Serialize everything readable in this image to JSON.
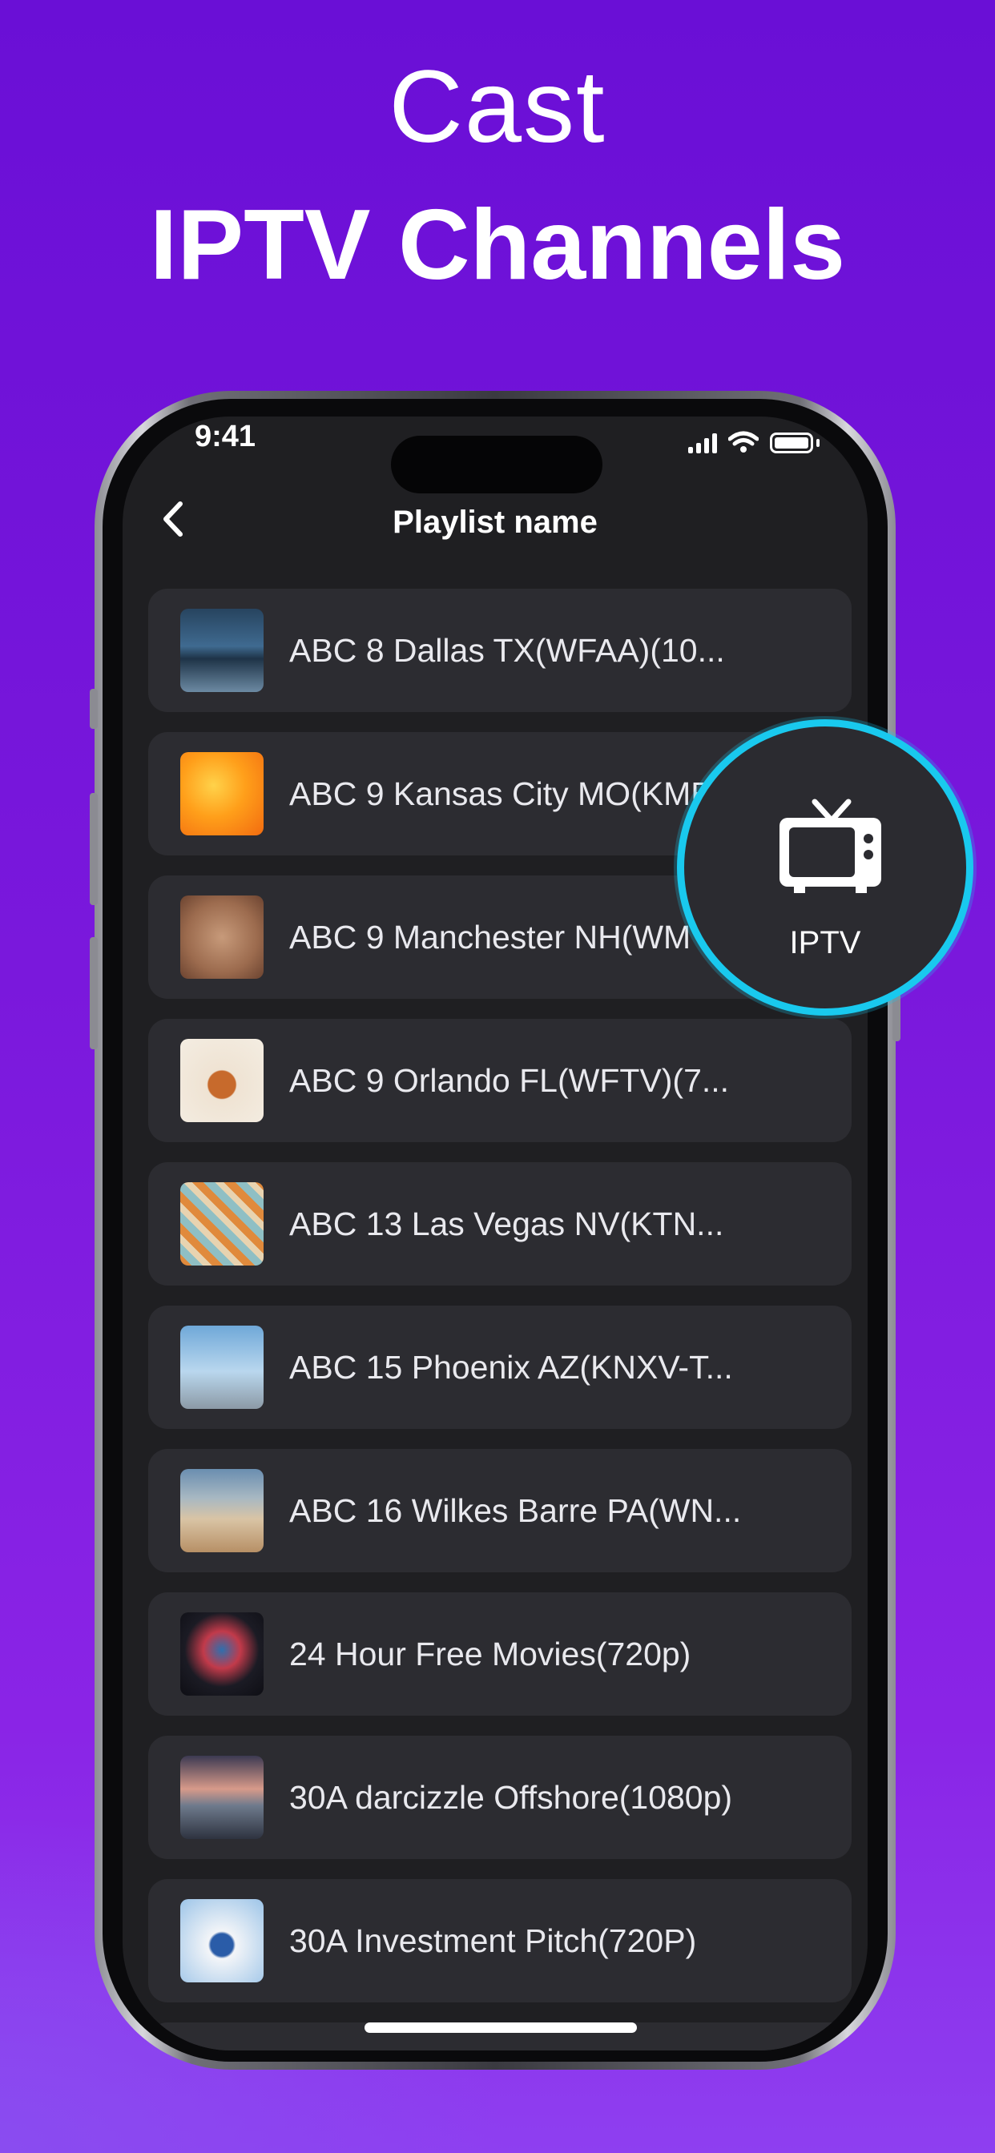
{
  "headline": {
    "line1": "Cast",
    "line2": "IPTV Channels"
  },
  "status_bar": {
    "time": "9:41"
  },
  "header": {
    "back_icon": "chevron-left-icon",
    "title": "Playlist name"
  },
  "channels": [
    {
      "name": "ABC 8 Dallas TX(WFAA)(10...",
      "thumb": "city-skyline-thumbnail"
    },
    {
      "name": "ABC 9 Kansas City MO(KMB",
      "thumb": "orange-abstract-thumbnail"
    },
    {
      "name": "ABC 9 Manchester NH(WM",
      "thumb": "brown-abstract-thumbnail"
    },
    {
      "name": "ABC 9 Orlando FL(WFTV)(7...",
      "thumb": "table-setting-thumbnail"
    },
    {
      "name": "ABC 13 Las Vegas NV(KTN...",
      "thumb": "pattern-thumbnail"
    },
    {
      "name": "ABC 15 Phoenix AZ(KNXV-T...",
      "thumb": "sky-person-thumbnail"
    },
    {
      "name": "ABC 16 Wilkes Barre PA(WN...",
      "thumb": "coastal-town-thumbnail"
    },
    {
      "name": "24 Hour Free Movies(720p)",
      "thumb": "hooded-figure-thumbnail"
    },
    {
      "name": "30A darcizzle Offshore(1080p)",
      "thumb": "sunset-thumbnail"
    },
    {
      "name": "30A Investment Pitch(720P)",
      "thumb": "santorini-thumbnail"
    }
  ],
  "badge": {
    "icon": "tv-icon",
    "label": "IPTV",
    "ring_color": "#19c9ee"
  },
  "colors": {
    "background": "#7a18dc",
    "screen": "#1f1f22",
    "row": "#2c2c31"
  }
}
